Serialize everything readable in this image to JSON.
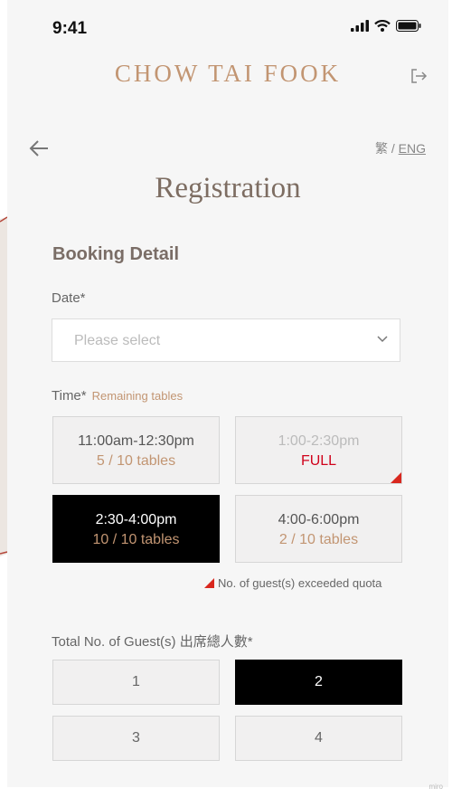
{
  "status_bar": {
    "time": "9:41"
  },
  "header": {
    "brand": "CHOW TAI FOOK"
  },
  "nav": {
    "lang_tc": "繁",
    "lang_sep": " / ",
    "lang_eng": "ENG"
  },
  "page": {
    "title": "Registration",
    "section": "Booking Detail"
  },
  "date": {
    "label": "Date*",
    "placeholder": "Please select"
  },
  "time": {
    "label": "Time*",
    "hint": "Remaining tables",
    "slots": [
      {
        "time": "11:00am-12:30pm",
        "note": "5 / 10 tables",
        "state": "available"
      },
      {
        "time": "1:00-2:30pm",
        "note": "FULL",
        "state": "full"
      },
      {
        "time": "2:30-4:00pm",
        "note": "10 / 10 tables",
        "state": "selected"
      },
      {
        "time": "4:00-6:00pm",
        "note": "2 / 10 tables",
        "state": "available"
      }
    ],
    "legend": "No. of guest(s) exceeded quota"
  },
  "guests": {
    "label": "Total No. of Guest(s) 出席總人數*",
    "options": [
      "1",
      "2",
      "3",
      "4"
    ],
    "selected": "2"
  },
  "watermark": "miro",
  "colors": {
    "accent": "#c29572",
    "full": "#d0021b",
    "selected_bg": "#000000"
  }
}
